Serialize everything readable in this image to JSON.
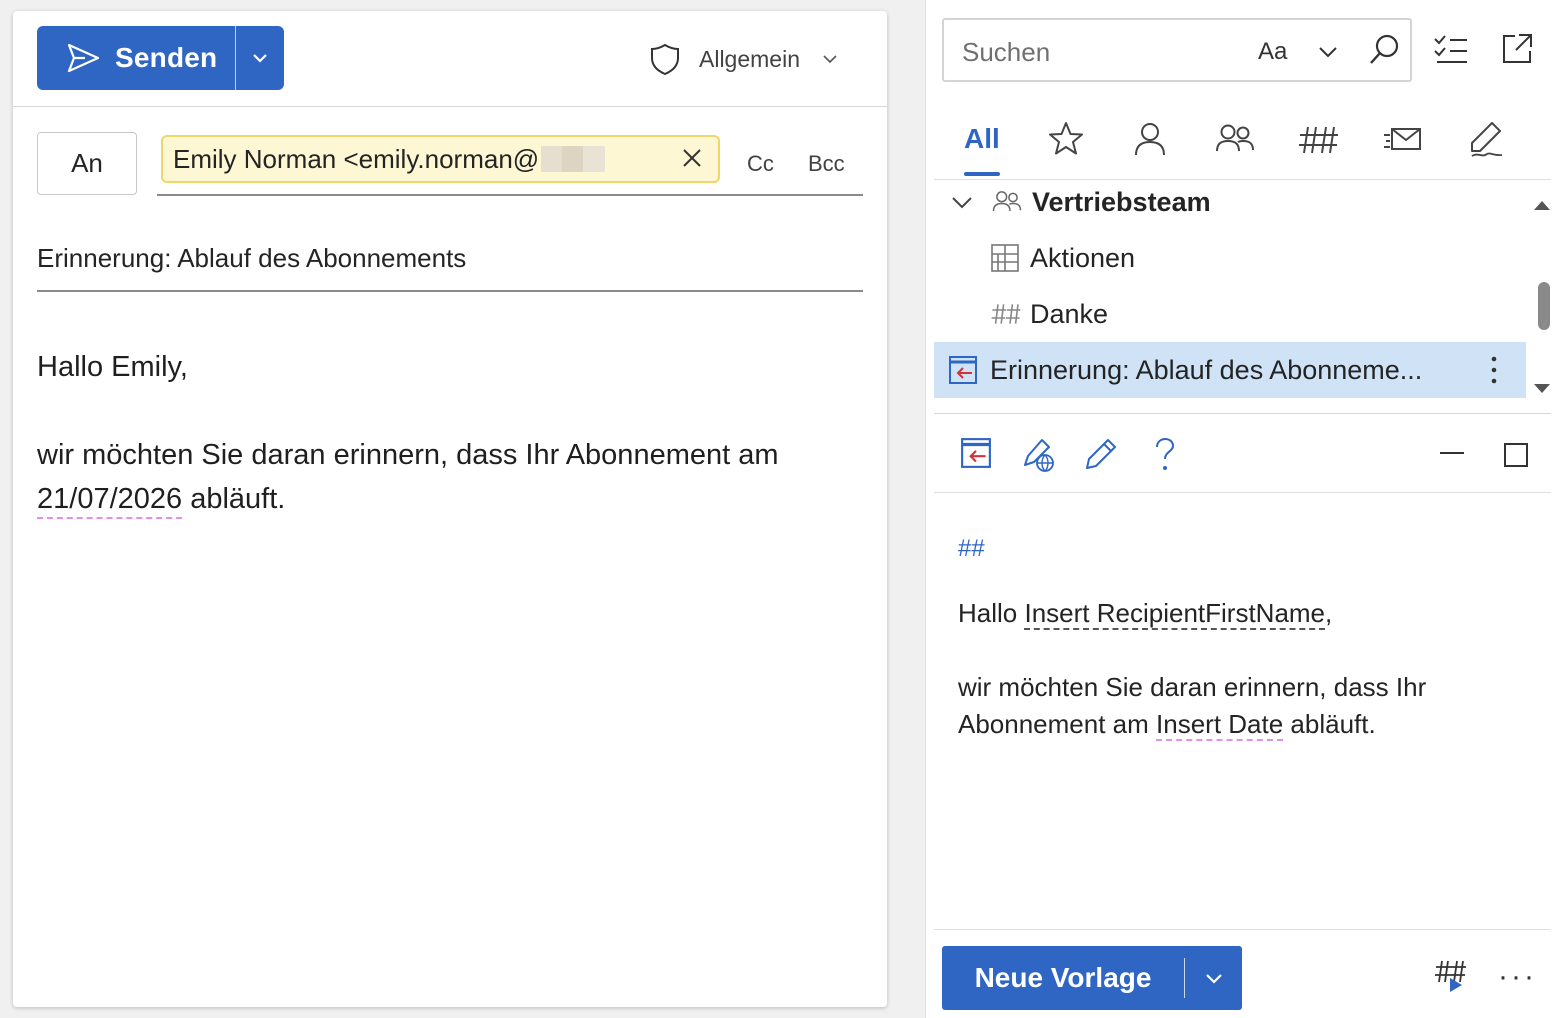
{
  "compose": {
    "send_label": "Senden",
    "sensitivity_label": "Allgemein",
    "to_label": "An",
    "recipient": "Emily Norman <emily.norman@",
    "cc_label": "Cc",
    "bcc_label": "Bcc",
    "subject": "Erinnerung: Ablauf des Abonnements",
    "body_greeting": "Hallo Emily,",
    "body_line_1": "wir möchten Sie daran erinnern, dass Ihr Abonnement am",
    "body_date": "21/07/2026",
    "body_line_2_rest": " abläuft."
  },
  "pane": {
    "search_placeholder": "Suchen",
    "match_case_label": "Aa",
    "tabs": {
      "all": "All"
    },
    "tree": {
      "group": "Vertriebsteam",
      "items": [
        {
          "label": "Aktionen"
        },
        {
          "label": "Danke"
        },
        {
          "label": "Erinnerung: Ablauf des Abonneme..."
        }
      ]
    },
    "preview": {
      "hash": "##",
      "greeting_prefix": "Hallo ",
      "placeholder_first_name": "Insert RecipientFirstName",
      "greeting_suffix": ",",
      "line_1": "wir möchten Sie daran erinnern, dass Ihr",
      "line_2_prefix": "Abonnement am ",
      "placeholder_date": "Insert Date",
      "line_2_suffix": " abläuft."
    },
    "new_template_label": "Neue Vorlage",
    "more_label": "···"
  },
  "colors": {
    "accent": "#2f66c4",
    "recipient_bg": "#fdf7d4",
    "recipient_border": "#f0d66a",
    "selected_row": "#cfe2f6",
    "spell_underline": "#e58ee5"
  }
}
